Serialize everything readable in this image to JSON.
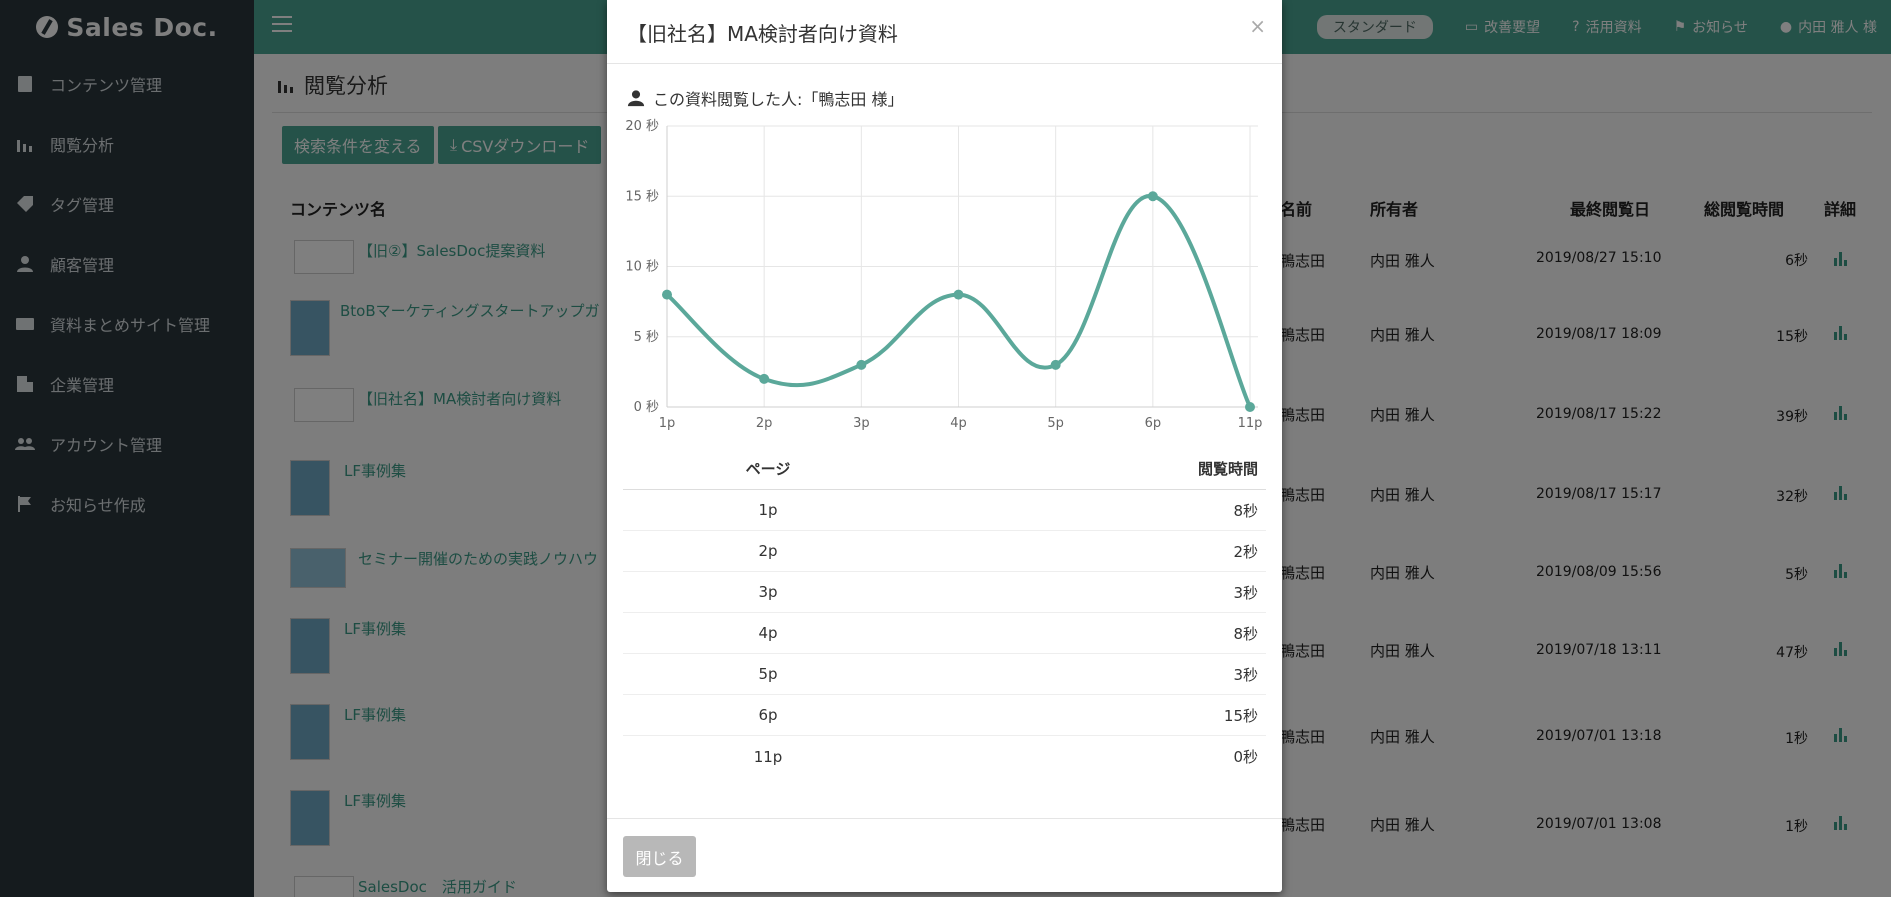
{
  "app": {
    "logo_text": "Sales Doc."
  },
  "sidebar": {
    "items": [
      {
        "label": "コンテンツ管理",
        "icon": "book-icon"
      },
      {
        "label": "閲覧分析",
        "icon": "bar-chart-icon"
      },
      {
        "label": "タグ管理",
        "icon": "tag-icon"
      },
      {
        "label": "顧客管理",
        "icon": "person-icon"
      },
      {
        "label": "資料まとめサイト管理",
        "icon": "card-icon"
      },
      {
        "label": "企業管理",
        "icon": "building-icon"
      },
      {
        "label": "アカウント管理",
        "icon": "people-icon"
      },
      {
        "label": "お知らせ作成",
        "icon": "flag-icon"
      }
    ]
  },
  "header": {
    "plan_badge": "スタンダード",
    "links": [
      {
        "label": "改善要望",
        "icon": "comment-icon"
      },
      {
        "label": "活用資料",
        "icon": "question-icon"
      },
      {
        "label": "お知らせ",
        "icon": "flag-icon"
      },
      {
        "label": "内田 雅人 様",
        "icon": "user-icon"
      }
    ]
  },
  "page": {
    "title": "閲覧分析",
    "search_button": "検索条件を変える",
    "csv_button": "CSVダウンロード",
    "columns": {
      "content": "コンテンツ名",
      "name": "名前",
      "owner": "所有者",
      "last_viewed": "最終閲覧日",
      "total_time": "総閲覧時間",
      "detail": "詳細"
    },
    "rows": [
      {
        "content": "【旧②】SalesDoc提案資料",
        "name": "鴨志田",
        "owner": "内田 雅人",
        "last_viewed": "2019/08/27 15:10",
        "total_time": "6秒"
      },
      {
        "content": "BtoBマーケティングスタートアップガ",
        "name": "鴨志田",
        "owner": "内田 雅人",
        "last_viewed": "2019/08/17 18:09",
        "total_time": "15秒"
      },
      {
        "content": "【旧社名】MA検討者向け資料",
        "name": "鴨志田",
        "owner": "内田 雅人",
        "last_viewed": "2019/08/17 15:22",
        "total_time": "39秒"
      },
      {
        "content": "LF事例集",
        "name": "鴨志田",
        "owner": "内田 雅人",
        "last_viewed": "2019/08/17 15:17",
        "total_time": "32秒"
      },
      {
        "content": "セミナー開催のための実践ノウハウ",
        "name": "鴨志田",
        "owner": "内田 雅人",
        "last_viewed": "2019/08/09 15:56",
        "total_time": "5秒"
      },
      {
        "content": "LF事例集",
        "name": "鴨志田",
        "owner": "内田 雅人",
        "last_viewed": "2019/07/18 13:11",
        "total_time": "47秒"
      },
      {
        "content": "LF事例集",
        "name": "鴨志田",
        "owner": "内田 雅人",
        "last_viewed": "2019/07/01 13:18",
        "total_time": "1秒"
      },
      {
        "content": "LF事例集",
        "name": "鴨志田",
        "owner": "内田 雅人",
        "last_viewed": "2019/07/01 13:08",
        "total_time": "1秒"
      },
      {
        "content": "SalesDoc　活用ガイド"
      }
    ]
  },
  "modal": {
    "title": "【旧社名】MA検討者向け資料",
    "close_symbol": "×",
    "viewer_text": "この資料閲覧した人:「鴨志田 様」",
    "table_headers": {
      "page": "ページ",
      "time": "閲覧時間"
    },
    "table_rows": [
      {
        "page": "1p",
        "time": "8秒"
      },
      {
        "page": "2p",
        "time": "2秒"
      },
      {
        "page": "3p",
        "time": "3秒"
      },
      {
        "page": "4p",
        "time": "8秒"
      },
      {
        "page": "5p",
        "time": "3秒"
      },
      {
        "page": "6p",
        "time": "15秒"
      },
      {
        "page": "11p",
        "time": "0秒"
      }
    ],
    "close_button": "閉じる"
  },
  "chart_data": {
    "type": "line",
    "categories": [
      "1p",
      "2p",
      "3p",
      "4p",
      "5p",
      "6p",
      "11p"
    ],
    "series": [
      {
        "values": [
          8,
          2,
          3,
          8,
          3,
          15,
          0
        ]
      }
    ],
    "y_tick_labels": [
      "0 秒",
      "5 秒",
      "10 秒",
      "15 秒",
      "20 秒"
    ],
    "ylim": [
      0,
      20
    ],
    "grid": true,
    "line_color": "#5ba89a"
  }
}
